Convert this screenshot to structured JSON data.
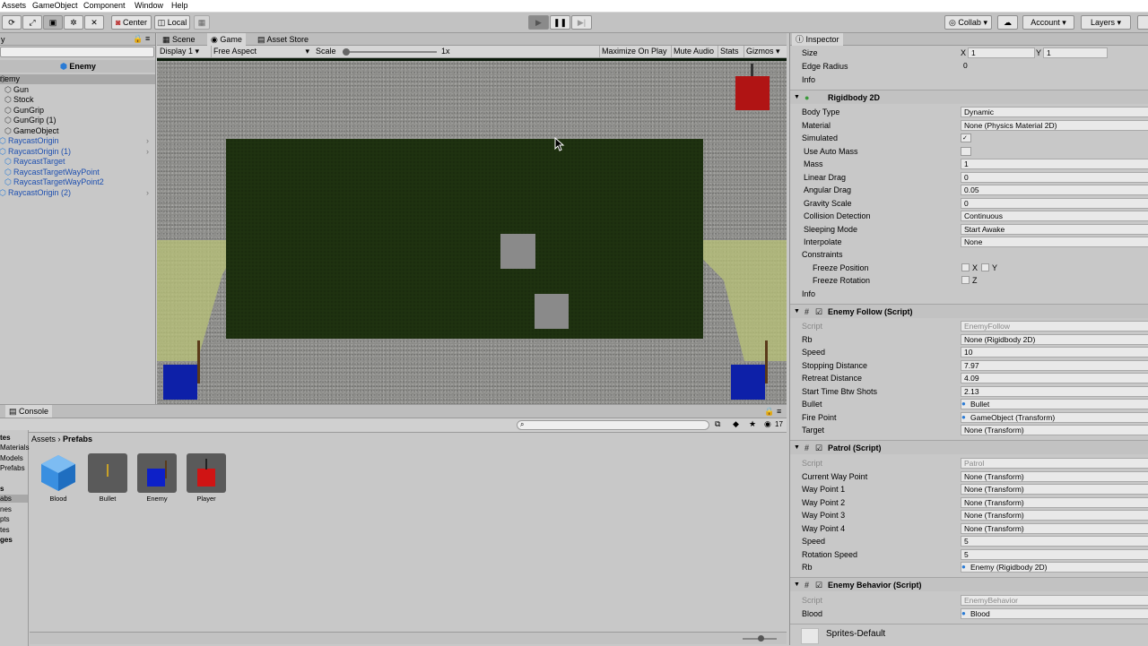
{
  "menu": [
    "Assets",
    "GameObject",
    "Component",
    "Window",
    "Help"
  ],
  "toolbar": {
    "pivot_center": "Center",
    "pivot_local": "Local",
    "collab": "Collab",
    "account": "Account",
    "layers": "Layers"
  },
  "hierarchy": {
    "scene_title": "Enemy",
    "rows": [
      {
        "label": "nemy",
        "blue": false
      },
      {
        "label": "Gun",
        "blue": false
      },
      {
        "label": "Stock",
        "blue": false
      },
      {
        "label": "GunGrip",
        "blue": false
      },
      {
        "label": "GunGrip (1)",
        "blue": false
      },
      {
        "label": "GameObject",
        "blue": false
      },
      {
        "label": "RaycastOrigin",
        "blue": true
      },
      {
        "label": "RaycastOrigin (1)",
        "blue": true
      },
      {
        "label": "RaycastTarget",
        "blue": true
      },
      {
        "label": "RaycastTargetWayPoint",
        "blue": true
      },
      {
        "label": "RaycastTargetWayPoint2",
        "blue": true
      },
      {
        "label": "RaycastOrigin (2)",
        "blue": true
      }
    ]
  },
  "tabs": [
    "Scene",
    "Game",
    "Asset Store"
  ],
  "gamebar": {
    "display": "Display 1",
    "aspect": "Free Aspect",
    "scale_label": "Scale",
    "scale_value": "1x",
    "maximize": "Maximize On Play",
    "mute": "Mute Audio",
    "stats": "Stats",
    "gizmos": "Gizmos"
  },
  "console": {
    "tab": "Console",
    "badge_count": "17",
    "breadcrumb_root": "Assets",
    "breadcrumb_sep": "›",
    "breadcrumb_leaf": "Prefabs",
    "left_folders": [
      "tes",
      "Materials",
      "Models",
      "Prefabs",
      "s",
      "abs",
      "nes",
      "pts",
      "tes",
      "ges"
    ],
    "assets": [
      "Blood",
      "Bullet",
      "Enemy",
      "Player"
    ]
  },
  "inspector": {
    "tab": "Inspector",
    "top": [
      {
        "k": "Size",
        "x_label": "X",
        "x": "1",
        "y_label": "Y",
        "y": "1"
      },
      {
        "k": "Edge Radius",
        "v": "0"
      },
      {
        "k": "Info"
      }
    ],
    "rigidbody": {
      "title": "Rigidbody 2D",
      "rows": [
        {
          "k": "Body Type",
          "v": "Dynamic"
        },
        {
          "k": "Material",
          "v": "None (Physics Material 2D)"
        },
        {
          "k": "Simulated",
          "v": "✓"
        },
        {
          "k": "Use Auto Mass",
          "v": ""
        },
        {
          "k": "Mass",
          "v": "1"
        },
        {
          "k": "Linear Drag",
          "v": "0"
        },
        {
          "k": "Angular Drag",
          "v": "0.05"
        },
        {
          "k": "Gravity Scale",
          "v": "0"
        },
        {
          "k": "Collision Detection",
          "v": "Continuous"
        },
        {
          "k": "Sleeping Mode",
          "v": "Start Awake"
        },
        {
          "k": "Interpolate",
          "v": "None"
        }
      ],
      "constraints": "Constraints",
      "freeze_pos": "Freeze Position",
      "freeze_rot": "Freeze Rotation",
      "x": "X",
      "y": "Y",
      "z": "Z",
      "info": "Info"
    },
    "enemy_follow": {
      "title": "Enemy Follow (Script)",
      "rows": [
        {
          "k": "Script",
          "v": "EnemyFollow"
        },
        {
          "k": "Rb",
          "v": "None (Rigidbody 2D)"
        },
        {
          "k": "Speed",
          "v": "10"
        },
        {
          "k": "Stopping Distance",
          "v": "7.97"
        },
        {
          "k": "Retreat Distance",
          "v": "4.09"
        },
        {
          "k": "Start Time Btw Shots",
          "v": "2.13"
        },
        {
          "k": "Bullet",
          "v": "Bullet"
        },
        {
          "k": "Fire Point",
          "v": "GameObject (Transform)"
        },
        {
          "k": "Target",
          "v": "None (Transform)"
        }
      ]
    },
    "patrol": {
      "title": "Patrol (Script)",
      "rows": [
        {
          "k": "Script",
          "v": "Patrol"
        },
        {
          "k": "Current Way Point",
          "v": "None (Transform)"
        },
        {
          "k": "Way Point 1",
          "v": "None (Transform)"
        },
        {
          "k": "Way Point 2",
          "v": "None (Transform)"
        },
        {
          "k": "Way Point 3",
          "v": "None (Transform)"
        },
        {
          "k": "Way Point 4",
          "v": "None (Transform)"
        },
        {
          "k": "Speed",
          "v": "5"
        },
        {
          "k": "Rotation Speed",
          "v": "5"
        },
        {
          "k": "Rb",
          "v": "Enemy (Rigidbody 2D)"
        }
      ]
    },
    "enemy_behavior": {
      "title": "Enemy Behavior (Script)",
      "rows": [
        {
          "k": "Script",
          "v": "EnemyBehavior"
        },
        {
          "k": "Blood",
          "v": "Blood"
        }
      ]
    },
    "sprites_default": "Sprites-Default"
  }
}
